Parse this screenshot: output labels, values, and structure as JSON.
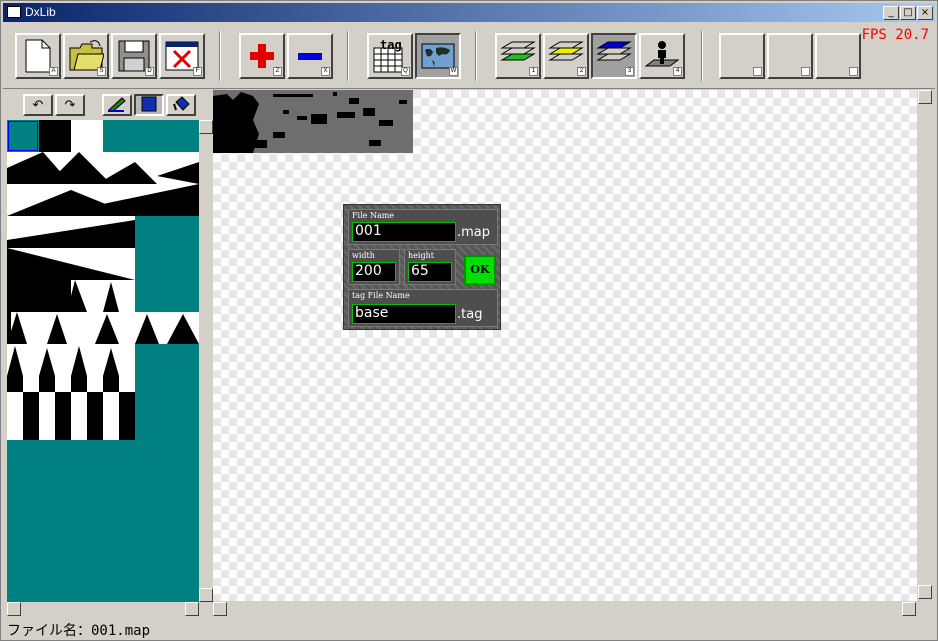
{
  "window": {
    "title": "DxLib"
  },
  "toolbar": {
    "fps": "FPS 20.7",
    "buttons": [
      {
        "name": "new-file",
        "key": "A",
        "icon": "new-document-icon"
      },
      {
        "name": "open-file",
        "key": "S",
        "icon": "open-folder-icon"
      },
      {
        "name": "save-file",
        "key": "D",
        "icon": "floppy-disk-icon"
      },
      {
        "name": "close-file",
        "key": "F",
        "icon": "close-window-icon"
      },
      {
        "name": "add",
        "key": "Z",
        "icon": "plus-icon"
      },
      {
        "name": "remove",
        "key": "X",
        "icon": "minus-icon"
      },
      {
        "name": "tag",
        "key": "Q",
        "icon": "tag-table-icon",
        "label": "tag"
      },
      {
        "name": "world-map",
        "key": "W",
        "icon": "world-map-icon"
      },
      {
        "name": "layer-1",
        "key": "1",
        "icon": "green-layer-icon"
      },
      {
        "name": "layer-2",
        "key": "2",
        "icon": "yellow-layer-icon"
      },
      {
        "name": "layer-3",
        "key": "3",
        "icon": "blue-layer-icon"
      },
      {
        "name": "layer-4",
        "key": "4",
        "icon": "character-layer-icon"
      }
    ]
  },
  "side_tools": [
    {
      "name": "undo",
      "icon": "undo-icon",
      "glyph": "↶"
    },
    {
      "name": "redo",
      "icon": "redo-icon",
      "glyph": "↷"
    },
    {
      "name": "pen",
      "icon": "pencil-icon"
    },
    {
      "name": "rect",
      "icon": "filled-square-icon"
    },
    {
      "name": "fill",
      "icon": "paint-bucket-icon"
    }
  ],
  "dialog": {
    "file_name_label": "File Name",
    "file_name_value": "001",
    "file_ext": ".map",
    "width_label": "width",
    "width_value": "200",
    "height_label": "height",
    "height_value": "65",
    "ok_label": "OK",
    "tag_label": "tag File Name",
    "tag_value": "base",
    "tag_ext": ".tag"
  },
  "status": {
    "text": "ファイル名：001.map"
  },
  "colors": {
    "palette_bg": "#008080",
    "accent_green": "#00e000",
    "fps": "#ff0000"
  }
}
